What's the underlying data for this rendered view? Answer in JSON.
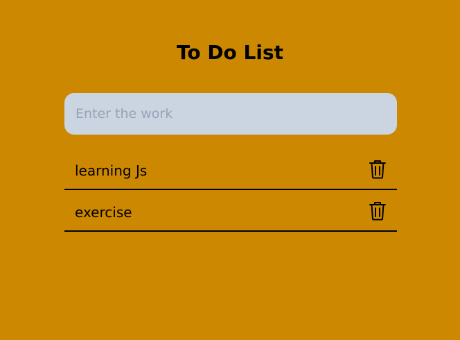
{
  "header": {
    "title": "To Do List"
  },
  "input": {
    "placeholder": "Enter the work",
    "value": ""
  },
  "todos": [
    {
      "text": "learning Js",
      "icon": "trash-icon"
    },
    {
      "text": "exercise",
      "icon": "trash-icon"
    }
  ],
  "colors": {
    "background": "#cc8800",
    "input_background": "#cbd5e1",
    "placeholder": "#94a3b8",
    "text": "#000000"
  }
}
